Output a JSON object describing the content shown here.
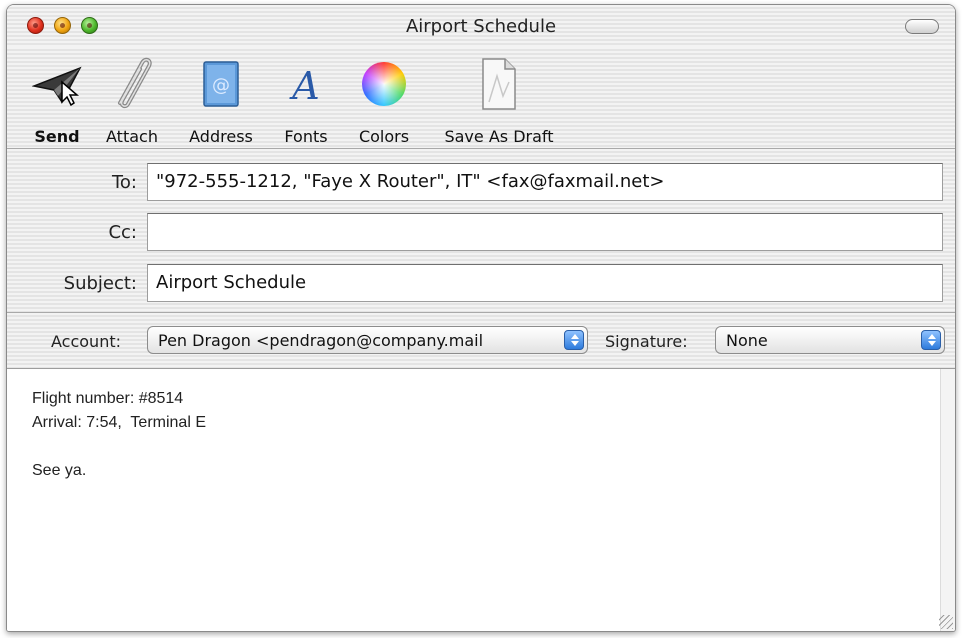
{
  "window": {
    "title": "Airport Schedule"
  },
  "toolbar": {
    "items": [
      {
        "label": "Send",
        "icon": "paper-plane-icon"
      },
      {
        "label": "Attach",
        "icon": "paperclip-icon"
      },
      {
        "label": "Address",
        "icon": "address-book-icon"
      },
      {
        "label": "Fonts",
        "icon": "font-a-icon"
      },
      {
        "label": "Colors",
        "icon": "color-wheel-icon"
      },
      {
        "label": "Save As Draft",
        "icon": "draft-page-icon"
      }
    ]
  },
  "fields": {
    "to_label": "To:",
    "to_value": "\"972-555-1212, \"Faye X Router\", IT\" <fax@faxmail.net>",
    "cc_label": "Cc:",
    "cc_value": "",
    "subject_label": "Subject:",
    "subject_value": "Airport Schedule"
  },
  "account_bar": {
    "account_label": "Account:",
    "account_value": "Pen Dragon <pendragon@company.mail",
    "signature_label": "Signature:",
    "signature_value": "None"
  },
  "body": {
    "lines": [
      "Flight number: #8514",
      "Arrival: 7:54,  Terminal E",
      "",
      "See ya."
    ]
  },
  "colors": {
    "close": "#e0301e",
    "minimize": "#f0a411",
    "zoom": "#4eb82c",
    "popup_arrow": "#2e7bdc"
  }
}
